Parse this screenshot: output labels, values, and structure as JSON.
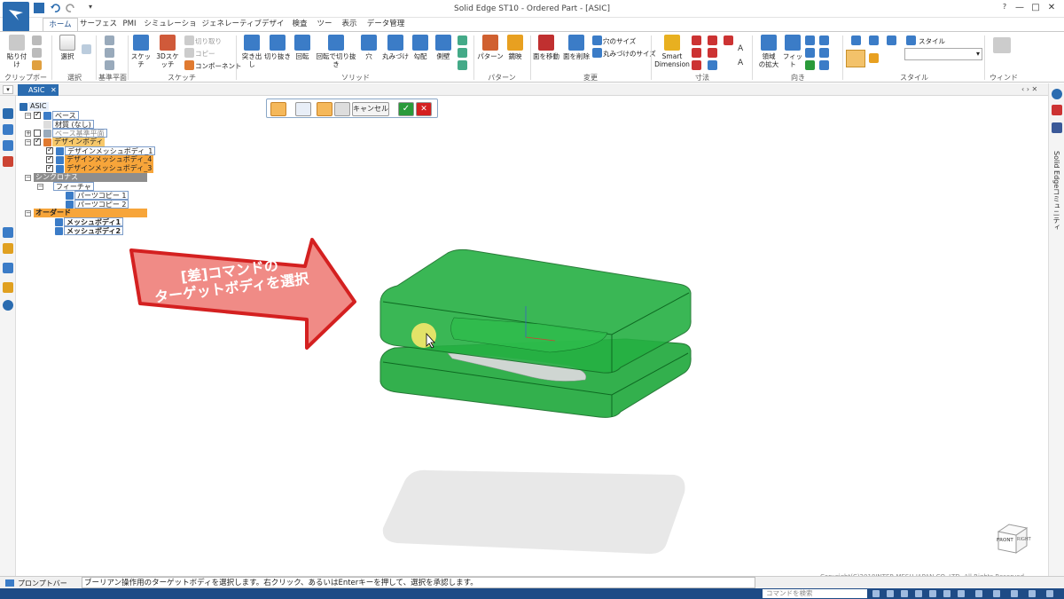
{
  "window": {
    "title": "Solid Edge ST10 - Ordered Part - [ASIC]"
  },
  "tabs": [
    "ホーム",
    "サーフェス",
    "PMI",
    "シミュレーション",
    "ジェネレーティブデザイン",
    "検査",
    "ツール",
    "表示",
    "データ管理"
  ],
  "ribbon": {
    "groups": [
      "クリップボード",
      "選択",
      "基準平面",
      "スケッチ",
      "ソリッド",
      "パターン",
      "変更",
      "寸法",
      "向き",
      "スタイル",
      "ウィンド"
    ],
    "clipboard": {
      "paste": "貼り付け"
    },
    "select": {
      "select": "選択"
    },
    "sketch": {
      "sketch": "スケッチ",
      "sketch3d": "3Dスケッチ",
      "cut": "切り取り",
      "copy": "コピー",
      "component": "コンポーネント"
    },
    "solid": {
      "extrude": "突き出し",
      "cutout": "切り抜き",
      "revolve": "回転",
      "revolve_cut": "回転で切り抜き",
      "hole": "穴",
      "round": "丸みづけ",
      "draft": "勾配",
      "thin_wall": "側壁"
    },
    "pattern": {
      "pattern": "パターン",
      "mirror": "鏡映"
    },
    "modify": {
      "move_face": "面を移動",
      "delete_face": "面を削除",
      "hole_size": "穴のサイズ",
      "round_size": "丸みづけのサイズ"
    },
    "dimension": {
      "smart_dimension_1": "Smart",
      "smart_dimension_2": "Dimension"
    },
    "orient": {
      "zoom_area_1": "領域",
      "zoom_area_2": "の拡大",
      "fit": "フィット"
    },
    "style": {
      "style": "スタイル"
    }
  },
  "document_tab": {
    "label": "ASIC"
  },
  "command_bar": {
    "cancel": "キャンセル"
  },
  "tree": {
    "root": "ASIC",
    "base": "ベース",
    "material": "材質 (なし)",
    "base_planes": "ベース基準平面",
    "design_body": "デザインボディ",
    "mesh1": "デザインメッシュボディ_1",
    "mesh2": "デザインメッシュボディ_4",
    "mesh3": "デザインメッシュボディ_3",
    "synchronous": "シンクロナス",
    "features": "フィーチャ",
    "partcopy1": "パーツコピー 1",
    "partcopy2": "パーツコピー 2",
    "ordered": "オーダード",
    "meshbody1": "メッシュボディ1",
    "meshbody2": "メッシュボディ2"
  },
  "callout": {
    "line1": "[差]コマンドの",
    "line2": "ターゲットボディを選択"
  },
  "viewcube": {
    "front": "FRONT",
    "right": "RIGHT"
  },
  "right_panel": {
    "label": "Solid Edgeコミュニティ"
  },
  "copyright": "Copyright(C)2018INTER MESH JAPAN CO.,LTD. All Rights Reserved.",
  "prompt": {
    "label": "プロンプトバー",
    "text": "ブーリアン操作用のターゲットボディを選択します。右クリック、あるいはEnterキーを押して、選択を承認します。"
  },
  "status": {
    "search_placeholder": "コマンドを検索"
  },
  "colors": {
    "accent": "#2b6cb0",
    "body_green": "#1eaa3c",
    "tree_highlight": "#f7a53a",
    "callout_red": "#d42020"
  }
}
